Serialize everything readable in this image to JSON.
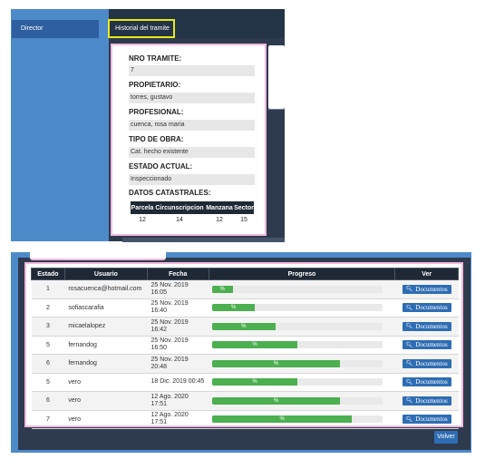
{
  "sidebar": {
    "item": "Director"
  },
  "tab": {
    "label": "Historial del tramite"
  },
  "fields": [
    {
      "label": "NRO TRAMITE:",
      "value": "7"
    },
    {
      "label": "PROPIETARIO:",
      "value": "torres, gustavo"
    },
    {
      "label": "PROFESIONAL:",
      "value": "cuenca, rosa maria"
    },
    {
      "label": "TIPO DE OBRA:",
      "value": "Cat. hecho existente"
    },
    {
      "label": "ESTADO ACTUAL:",
      "value": "Inspeccionado"
    }
  ],
  "catastro": {
    "label": "DATOS CATASTRALES:",
    "headers": [
      "Parcela",
      "Circunscripcion",
      "Manzana",
      "Sector"
    ],
    "row": [
      "12",
      "14",
      "12",
      "15"
    ]
  },
  "history": {
    "headers": [
      "Estado",
      "Usuario",
      "Fecha",
      "Progreso",
      "Ver"
    ],
    "rows": [
      {
        "estado": "1",
        "usuario": "rosacuenca@hotmail.com",
        "fecha": "25 Nov. 2019\n16:05",
        "progress": 0.12,
        "pct": "%",
        "ver": "Documentos"
      },
      {
        "estado": "2",
        "usuario": "sofiascarafia",
        "fecha": "25 Nov. 2019\n16:40",
        "progress": 0.25,
        "pct": "%",
        "ver": "Documentos"
      },
      {
        "estado": "3",
        "usuario": "micaelalopez",
        "fecha": "25 Nov. 2019\n16:42",
        "progress": 0.37,
        "pct": "%",
        "ver": "Documentos"
      },
      {
        "estado": "5",
        "usuario": "fernandog",
        "fecha": "25 Nov. 2019\n16:50",
        "progress": 0.5,
        "pct": "%",
        "ver": "Documentos"
      },
      {
        "estado": "6",
        "usuario": "fernandog",
        "fecha": "25 Nov. 2019\n20:48",
        "progress": 0.75,
        "pct": "%",
        "ver": "Documentos"
      },
      {
        "estado": "5",
        "usuario": "vero",
        "fecha": "18 Dic. 2019 00:45",
        "progress": 0.5,
        "pct": "%",
        "ver": "Documentos"
      },
      {
        "estado": "6",
        "usuario": "vero",
        "fecha": "12 Ago. 2020\n17:51",
        "progress": 0.75,
        "pct": "%",
        "ver": "Documentos"
      },
      {
        "estado": "7",
        "usuario": "vero",
        "fecha": "12 Ago. 2020\n17:51",
        "progress": 0.82,
        "pct": "%",
        "ver": "Documentos"
      }
    ]
  },
  "volver": "Volver",
  "colors": {
    "accent": "#2e6db3",
    "progress": "#4caf50",
    "dark": "#2e3a4e",
    "highlight": "#e8e81a",
    "pink": "#f2b9dc"
  },
  "icons": {
    "documentos": "search-icon"
  }
}
